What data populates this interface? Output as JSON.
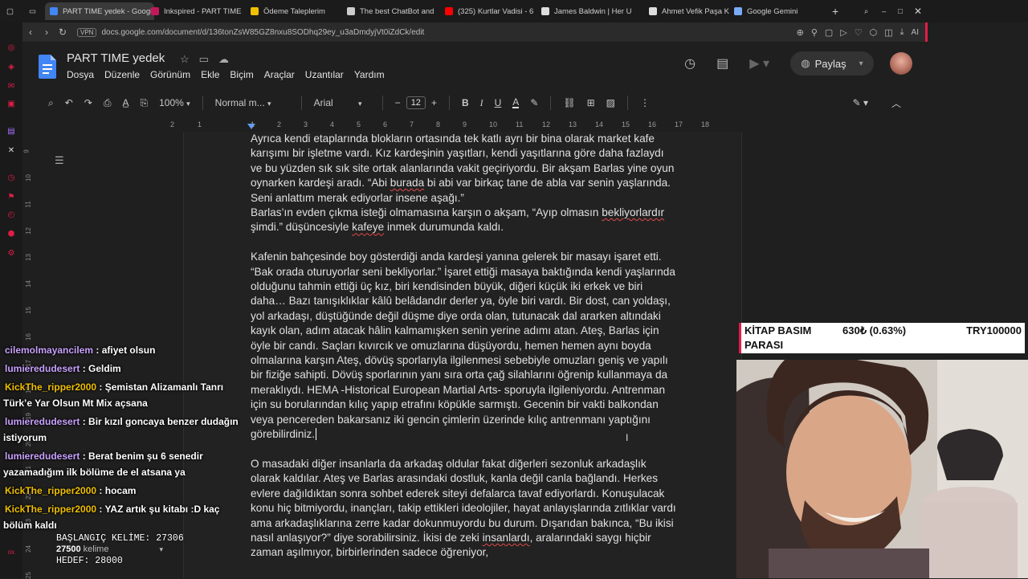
{
  "tabs": [
    {
      "label": "PART TIME yedek - Google",
      "active": true,
      "color": "#4285f4"
    },
    {
      "label": "Inkspired - PART TIME",
      "color": "#c2185b"
    },
    {
      "label": "Ödeme Taleplerim",
      "color": "#f0c000"
    },
    {
      "label": "The best ChatBot and",
      "color": "#cccccc"
    },
    {
      "label": "(325) Kurtlar Vadisi - 6",
      "color": "#ff0000"
    },
    {
      "label": "James Baldwin | Her U",
      "color": "#dddddd"
    },
    {
      "label": "Ahmet Vefik Paşa Kütü",
      "color": "#dddddd"
    },
    {
      "label": "Google Gemini",
      "color": "#7baaf7"
    }
  ],
  "address": {
    "vpn": "VPN",
    "url": "docs.google.com/document/d/136tonZsW85GZ8nxu8SODhq29ey_u3aDmdyjVt0iZdCk/edit",
    "ai_label": "AI"
  },
  "docs": {
    "title": "PART TIME  yedek",
    "menus": [
      "Dosya",
      "Düzenle",
      "Görünüm",
      "Ekle",
      "Biçim",
      "Araçlar",
      "Uzantılar",
      "Yardım"
    ],
    "share_label": "Paylaş"
  },
  "toolbar": {
    "zoom": "100%",
    "style": "Normal m...",
    "font": "Arial",
    "font_size": "12"
  },
  "ruler": [
    "2",
    "1",
    "1",
    "2",
    "3",
    "4",
    "5",
    "6",
    "7",
    "8",
    "9",
    "10",
    "11",
    "12",
    "13",
    "14",
    "15",
    "16",
    "17",
    "18"
  ],
  "vruler": [
    "9",
    "10",
    "11",
    "12",
    "13",
    "14",
    "15",
    "16",
    "17",
    "18",
    "19",
    "20",
    "21",
    "22",
    "23",
    "24",
    "25"
  ],
  "document": {
    "p1": "Ayrıca kendi etaplarında blokların ortasında tek katlı ayrı bir bina olarak market kafe karışımı bir işletme vardı. Kız kardeşinin yaşıtları, kendi yaşıtlarına göre daha fazlaydı ve bu yüzden sık sık site ortak alanlarında vakit geçiriyordu. Bir akşam Barlas yine oyun oynarken kardeşi aradı. “Abi ",
    "p1_u1": "burada",
    "p1_b": " bi abi var birkaç tane de abla var senin yaşlarında. Seni anlattım merak ediyorlar insene aşağı.”",
    "p2_a": "Barlas’ın evden çıkma isteği olmamasına karşın o akşam, “Ayıp olmasın ",
    "p2_u1": "bekliyorlardır",
    "p2_b": " şimdi.” düşüncesiyle ",
    "p2_u2": "kafeye",
    "p2_c": " inmek durumunda kaldı.",
    "p3": "Kafenin bahçesinde boy gösterdiği anda kardeşi yanına gelerek bir masayı işaret etti. “Bak orada oturuyorlar seni bekliyorlar.” İşaret ettiği masaya baktığında kendi yaşlarında olduğunu tahmin ettiği üç kız, biri kendisinden büyük, diğeri küçük iki erkek ve biri daha… Bazı tanışıklıklar kâlû belâdandır derler ya, öyle biri vardı. Bir dost, can yoldaşı, yol arkadaşı, düştüğünde değil düşme diye orda olan, tutunacak dal ararken altındaki kayık olan, adım atacak hâlin kalmamışken senin yerine adımı atan. Ateş, Barlas için öyle bir candı. Saçları kıvırcık ve omuzlarına düşüyordu, hemen hemen aynı boyda olmalarına karşın Ateş, dövüş sporlarıyla ilgilenmesi sebebiyle omuzları geniş ve yapılı bir fiziğe sahipti. Dövüş sporlarının yanı sıra orta çağ silahlarını öğrenip kullanmaya da meraklıydı. HEMA -Historical European Martial Arts- sporuyla ilgileniyordu. Antrenman için su borularından kılıç yapıp etrafını köpükle sarmıştı. Gecenin bir vakti balkondan veya pencereden bakarsanız iki gencin çimlerin üzerinde kılıç antrenmanı yaptığını görebilirdiniz.",
    "p4_a": "O masadaki diğer insanlarla da arkadaş oldular fakat diğerleri sezonluk arkadaşlık olarak kaldılar. Ateş ve Barlas arasındaki dostluk, kanla değil canla bağlandı. Herkes evlere dağıldıktan sonra sohbet ederek siteyi defalarca tavaf ediyorlardı. Konuşulacak konu hiç bitmiyordu, inançları, takip ettikleri ideolojiler, hayat anlayışlarında zıtlıklar vardı ama arkadaşlıklarına zerre kadar dokunmuyordu bu durum. Dışarıdan bakınca, “Bu ikisi nasıl anlaşıyor?” diye sorabilirsiniz. İkisi de zeki ",
    "p4_u1": "insanlardı",
    "p4_b": ", aralarındaki saygı hiçbir zaman aşılmıyor, birbirlerinden sadece öğreniyor,"
  },
  "chat": [
    {
      "user": "cilemolmayancilem",
      "color": "#c9a0ff",
      "text": "afiyet olsun"
    },
    {
      "user": "lumieredudesert",
      "color": "#c9a0ff",
      "text": "Geldim"
    },
    {
      "user": "KickThe_ripper2000",
      "color": "#f0c000",
      "text": "Şemistan Alizamanlı Tanrı Türk’e Yar Olsun Mt Mix açsana"
    },
    {
      "user": "lumieredudesert",
      "color": "#c9a0ff",
      "text": "Bir kızıl goncaya benzer dudağın istiyorum"
    },
    {
      "user": "lumieredudesert",
      "color": "#c9a0ff",
      "text": "Berat benim şu 6 senedir yazamadığım ilk bölüme de el atsana ya"
    },
    {
      "user": "KickThe_ripper2000",
      "color": "#f0c000",
      "text": "hocam"
    },
    {
      "user": "KickThe_ripper2000",
      "color": "#f0c000",
      "text": "YAZ artık şu kitabı :D kaç bölüm kaldı"
    }
  ],
  "counter": {
    "start": "BAŞLANGIÇ KELİME: 27306",
    "words_num": "27500",
    "words_label": "kelime",
    "goal": "HEDEF: 28000"
  },
  "goal_box": {
    "label": "KİTAP BASIM PARASI",
    "amount": "630₺ (0.63%)",
    "target": "TRY100000",
    "progress_percent": 0.63
  }
}
